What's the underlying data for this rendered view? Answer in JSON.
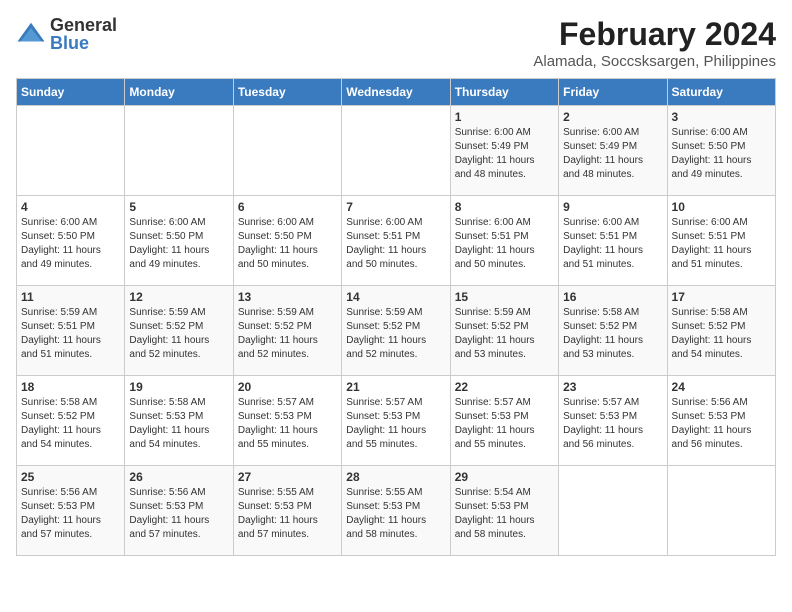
{
  "logo": {
    "general": "General",
    "blue": "Blue"
  },
  "title": "February 2024",
  "subtitle": "Alamada, Soccsksargen, Philippines",
  "weekdays": [
    "Sunday",
    "Monday",
    "Tuesday",
    "Wednesday",
    "Thursday",
    "Friday",
    "Saturday"
  ],
  "weeks": [
    [
      {
        "day": "",
        "info": ""
      },
      {
        "day": "",
        "info": ""
      },
      {
        "day": "",
        "info": ""
      },
      {
        "day": "",
        "info": ""
      },
      {
        "day": "1",
        "info": "Sunrise: 6:00 AM\nSunset: 5:49 PM\nDaylight: 11 hours\nand 48 minutes."
      },
      {
        "day": "2",
        "info": "Sunrise: 6:00 AM\nSunset: 5:49 PM\nDaylight: 11 hours\nand 48 minutes."
      },
      {
        "day": "3",
        "info": "Sunrise: 6:00 AM\nSunset: 5:50 PM\nDaylight: 11 hours\nand 49 minutes."
      }
    ],
    [
      {
        "day": "4",
        "info": "Sunrise: 6:00 AM\nSunset: 5:50 PM\nDaylight: 11 hours\nand 49 minutes."
      },
      {
        "day": "5",
        "info": "Sunrise: 6:00 AM\nSunset: 5:50 PM\nDaylight: 11 hours\nand 49 minutes."
      },
      {
        "day": "6",
        "info": "Sunrise: 6:00 AM\nSunset: 5:50 PM\nDaylight: 11 hours\nand 50 minutes."
      },
      {
        "day": "7",
        "info": "Sunrise: 6:00 AM\nSunset: 5:51 PM\nDaylight: 11 hours\nand 50 minutes."
      },
      {
        "day": "8",
        "info": "Sunrise: 6:00 AM\nSunset: 5:51 PM\nDaylight: 11 hours\nand 50 minutes."
      },
      {
        "day": "9",
        "info": "Sunrise: 6:00 AM\nSunset: 5:51 PM\nDaylight: 11 hours\nand 51 minutes."
      },
      {
        "day": "10",
        "info": "Sunrise: 6:00 AM\nSunset: 5:51 PM\nDaylight: 11 hours\nand 51 minutes."
      }
    ],
    [
      {
        "day": "11",
        "info": "Sunrise: 5:59 AM\nSunset: 5:51 PM\nDaylight: 11 hours\nand 51 minutes."
      },
      {
        "day": "12",
        "info": "Sunrise: 5:59 AM\nSunset: 5:52 PM\nDaylight: 11 hours\nand 52 minutes."
      },
      {
        "day": "13",
        "info": "Sunrise: 5:59 AM\nSunset: 5:52 PM\nDaylight: 11 hours\nand 52 minutes."
      },
      {
        "day": "14",
        "info": "Sunrise: 5:59 AM\nSunset: 5:52 PM\nDaylight: 11 hours\nand 52 minutes."
      },
      {
        "day": "15",
        "info": "Sunrise: 5:59 AM\nSunset: 5:52 PM\nDaylight: 11 hours\nand 53 minutes."
      },
      {
        "day": "16",
        "info": "Sunrise: 5:58 AM\nSunset: 5:52 PM\nDaylight: 11 hours\nand 53 minutes."
      },
      {
        "day": "17",
        "info": "Sunrise: 5:58 AM\nSunset: 5:52 PM\nDaylight: 11 hours\nand 54 minutes."
      }
    ],
    [
      {
        "day": "18",
        "info": "Sunrise: 5:58 AM\nSunset: 5:52 PM\nDaylight: 11 hours\nand 54 minutes."
      },
      {
        "day": "19",
        "info": "Sunrise: 5:58 AM\nSunset: 5:53 PM\nDaylight: 11 hours\nand 54 minutes."
      },
      {
        "day": "20",
        "info": "Sunrise: 5:57 AM\nSunset: 5:53 PM\nDaylight: 11 hours\nand 55 minutes."
      },
      {
        "day": "21",
        "info": "Sunrise: 5:57 AM\nSunset: 5:53 PM\nDaylight: 11 hours\nand 55 minutes."
      },
      {
        "day": "22",
        "info": "Sunrise: 5:57 AM\nSunset: 5:53 PM\nDaylight: 11 hours\nand 55 minutes."
      },
      {
        "day": "23",
        "info": "Sunrise: 5:57 AM\nSunset: 5:53 PM\nDaylight: 11 hours\nand 56 minutes."
      },
      {
        "day": "24",
        "info": "Sunrise: 5:56 AM\nSunset: 5:53 PM\nDaylight: 11 hours\nand 56 minutes."
      }
    ],
    [
      {
        "day": "25",
        "info": "Sunrise: 5:56 AM\nSunset: 5:53 PM\nDaylight: 11 hours\nand 57 minutes."
      },
      {
        "day": "26",
        "info": "Sunrise: 5:56 AM\nSunset: 5:53 PM\nDaylight: 11 hours\nand 57 minutes."
      },
      {
        "day": "27",
        "info": "Sunrise: 5:55 AM\nSunset: 5:53 PM\nDaylight: 11 hours\nand 57 minutes."
      },
      {
        "day": "28",
        "info": "Sunrise: 5:55 AM\nSunset: 5:53 PM\nDaylight: 11 hours\nand 58 minutes."
      },
      {
        "day": "29",
        "info": "Sunrise: 5:54 AM\nSunset: 5:53 PM\nDaylight: 11 hours\nand 58 minutes."
      },
      {
        "day": "",
        "info": ""
      },
      {
        "day": "",
        "info": ""
      }
    ]
  ]
}
